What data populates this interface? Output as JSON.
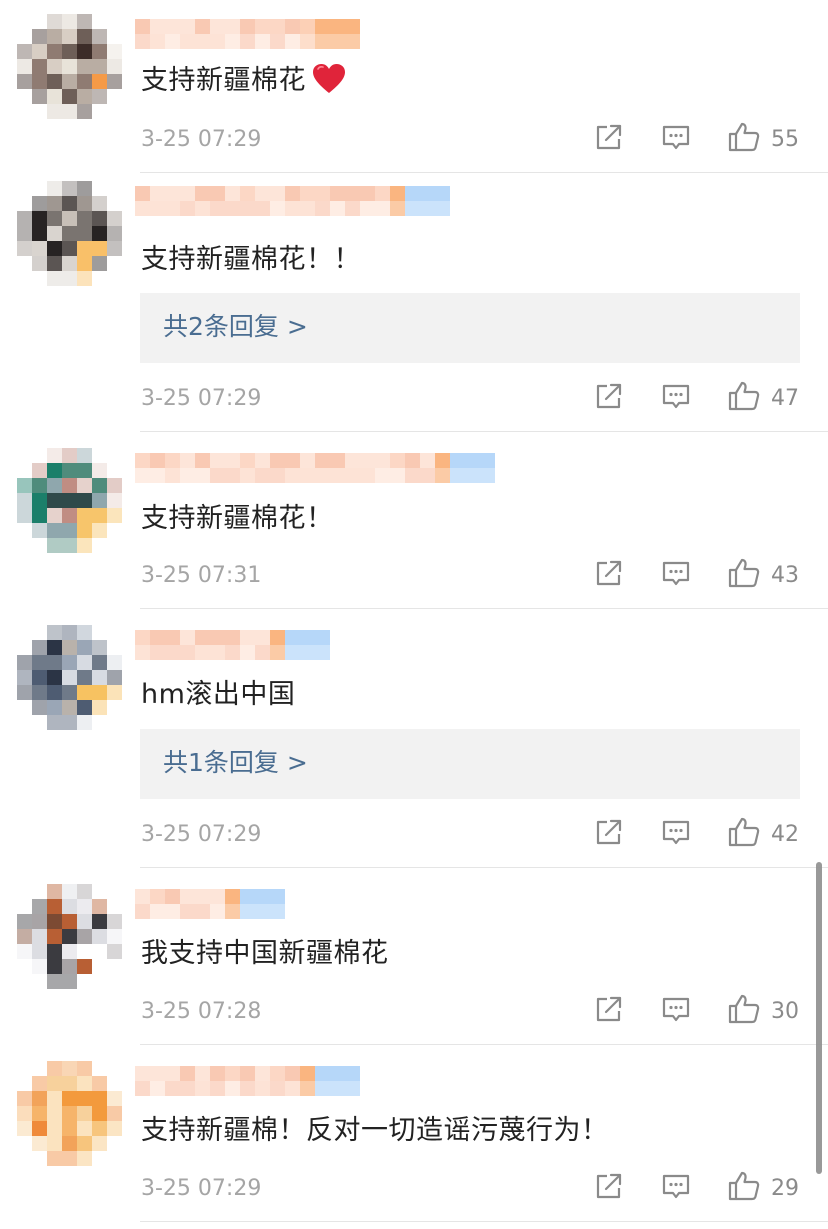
{
  "comments": [
    {
      "avatar_palette": [
        "#e8e3d9",
        "#b9ada3",
        "#6e5f58",
        "#3c2c28",
        "#8f7b72",
        "#d8cec4",
        "#f59a47"
      ],
      "username_palette": [
        "#fde1d2",
        "#fbd0bb",
        "#f8bfa6",
        "#fbc8a9",
        "#f9a86a"
      ],
      "text": "支持新疆棉花",
      "has_heart": true,
      "reply_label": null,
      "time": "3-25 07:29",
      "likes": "55"
    },
    {
      "avatar_palette": [
        "#d9d4cf",
        "#9f9791",
        "#5b5553",
        "#272323",
        "#7a7470",
        "#c8c0b8",
        "#f9c069"
      ],
      "username_palette": [
        "#fde1d2",
        "#fbd0bb",
        "#f8bfa6",
        "#f9a86a",
        "#a9d0f8"
      ],
      "text": "支持新疆棉花！！",
      "has_heart": false,
      "reply_label": "共2条回复 >",
      "time": "3-25 07:29",
      "likes": "47"
    },
    {
      "avatar_palette": [
        "#4f8c7c",
        "#2f4a4a",
        "#1b7f6a",
        "#c08d83",
        "#8fa7ad",
        "#e6d2cc",
        "#f7c56b"
      ],
      "username_palette": [
        "#fde1d2",
        "#fbd0bb",
        "#f8bfa6",
        "#f9a86a",
        "#a9d0f8"
      ],
      "text": "支持新疆棉花！",
      "has_heart": false,
      "reply_label": null,
      "time": "3-25 07:31",
      "likes": "43"
    },
    {
      "avatar_palette": [
        "#9aa6b6",
        "#4e5c72",
        "#2b3445",
        "#b9b2ab",
        "#6f7a89",
        "#d7dbe2",
        "#f7c261"
      ],
      "username_palette": [
        "#fde1d2",
        "#fbd0bb",
        "#f8bfa6",
        "#f9a86a",
        "#a9d0f8"
      ],
      "text": "hm滚出中国",
      "has_heart": false,
      "reply_label": "共1条回复 >",
      "time": "3-25 07:29",
      "likes": "42"
    },
    {
      "avatar_palette": [
        "#dcdde2",
        "#a8a4a6",
        "#3b3b40",
        "#b85f34",
        "#7c4a33",
        "#ecebef",
        "#ffffff"
      ],
      "username_palette": [
        "#fde1d2",
        "#fbd0bb",
        "#f8bfa6",
        "#f9a86a",
        "#a9d0f8"
      ],
      "text": "我支持中国新疆棉花",
      "has_heart": false,
      "reply_label": null,
      "time": "3-25 07:28",
      "likes": "30"
    },
    {
      "avatar_palette": [
        "#f6b46a",
        "#f39a3d",
        "#ef8a3a",
        "#f7d19c",
        "#fbe3bf",
        "#f2a35a",
        "#f7c57d"
      ],
      "username_palette": [
        "#fde1d2",
        "#fbd0bb",
        "#f8bfa6",
        "#f9a86a",
        "#a9d0f8"
      ],
      "text": "支持新疆棉！反对一切造谣污蔑行为！",
      "has_heart": false,
      "reply_label": null,
      "time": "3-25 07:29",
      "likes": "29"
    }
  ],
  "icons": {
    "share": "share-icon",
    "comment": "comment-icon",
    "like": "thumbs-up-icon",
    "heart": "red-heart-emoji"
  },
  "colors": {
    "reply_link": "#4a6d91",
    "meta_text": "#a5a5a5",
    "heart": "#e0243a"
  }
}
